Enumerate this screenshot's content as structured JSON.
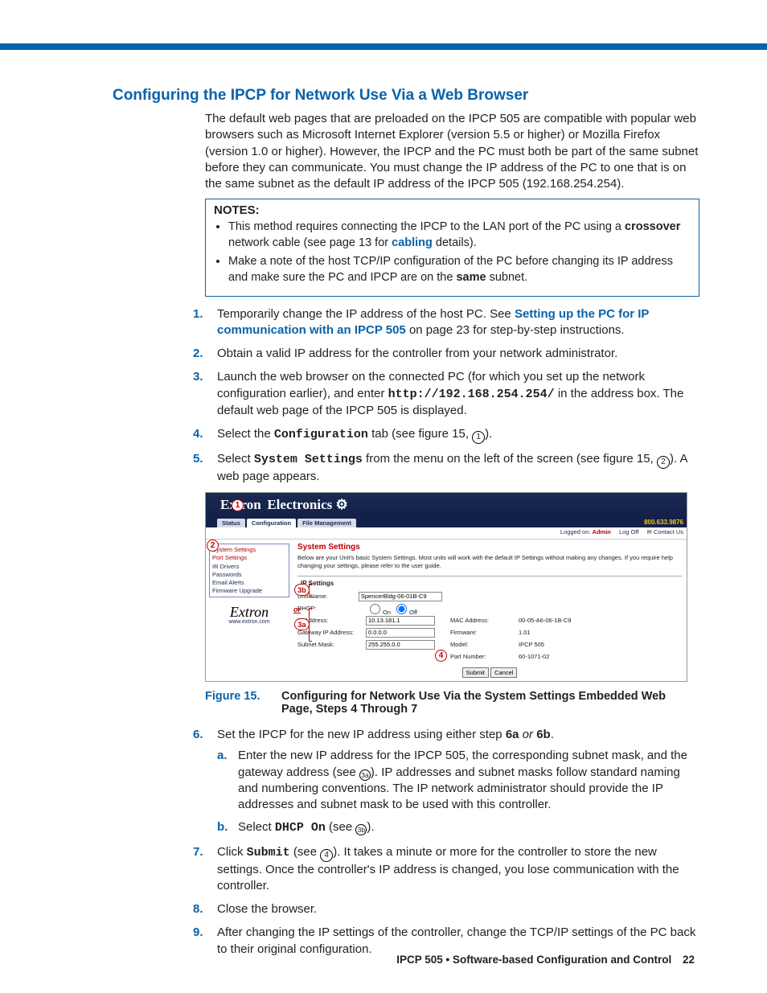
{
  "heading": "Configuring the IPCP for Network Use Via a Web Browser",
  "intro": "The default web pages that are preloaded on the IPCP 505 are compatible with popular web browsers such as Microsoft Internet Explorer (version 5.5 or higher) or Mozilla Firefox (version 1.0 or higher). However, the IPCP and the PC must both be part of the same subnet before they can communicate. You must change the IP address of the PC to one that is on the same subnet as the default IP address of the IPCP 505 (192.168.254.254).",
  "notes_label": "NOTES:",
  "notes": {
    "n1_a": "This method requires connecting the IPCP to the LAN port of the PC using a ",
    "n1_b": "crossover",
    "n1_c": " network cable (see page 13 for ",
    "n1_link": "cabling",
    "n1_d": " details).",
    "n2_a": "Make a note of the host TCP/IP configuration of the PC before changing its IP address and make sure the PC and IPCP are on the ",
    "n2_b": "same",
    "n2_c": " subnet."
  },
  "steps": {
    "s1_a": "Temporarily change the IP address of the host PC. See ",
    "s1_link": "Setting up the PC for IP communication with an IPCP 505",
    "s1_b": " on page 23 for step-by-step instructions.",
    "s2": "Obtain a valid IP address for the controller from your network administrator.",
    "s3_a": "Launch the web browser on the connected PC (for which you set up the network configuration earlier), and enter ",
    "s3_code": "http://192.168.254.254/",
    "s3_b": " in the address box. The default web page of the IPCP 505 is displayed.",
    "s4_a": "Select the ",
    "s4_code": "Configuration",
    "s4_b": " tab (see figure 15, ",
    "s4_c": ").",
    "s5_a": "Select ",
    "s5_code": "System Settings",
    "s5_b": " from the menu on the left of the screen (see figure 15, ",
    "s5_c": "). A web page appears.",
    "s6_a": "Set the IPCP for the new IP address using either step ",
    "s6_b": "6a",
    "s6_or": " or ",
    "s6_c": "6b",
    "s6_d": ".",
    "s6a_a": "Enter the new IP address for the IPCP 505, the corresponding subnet mask, and the gateway address (see ",
    "s6a_b": "). IP addresses and subnet masks follow standard naming and numbering conventions. The IP network administrator should provide the IP addresses and subnet mask to be used with this controller.",
    "s6b_a": "Select ",
    "s6b_code": "DHCP On",
    "s6b_b": " (see ",
    "s6b_c": ").",
    "s7_a": "Click ",
    "s7_code": "Submit",
    "s7_b": " (see ",
    "s7_c": "). It takes a minute or more for the controller to store the new settings. Once the controller's IP address is changed, you lose communication with the controller.",
    "s8": "Close the browser.",
    "s9": "After changing the IP settings of the controller, change the TCP/IP settings of the PC back to their original configuration."
  },
  "callout_labels": {
    "c1": "1",
    "c2": "2",
    "c3a": "3a",
    "c3b": "3b",
    "c4": "4",
    "or": "or"
  },
  "fig_label": "Figure 15.",
  "fig_text": "Configuring for Network Use Via the System Settings Embedded Web Page, Steps 4 Through 7",
  "webshot": {
    "brand": "Extron  Electronics ⚙",
    "phone": "800.633.9876",
    "tabs": {
      "status": "Status",
      "config": "Configuration",
      "file": "File Management"
    },
    "top": {
      "logged": "Logged on: ",
      "admin": "Admin",
      "logoff": "Log Off",
      "contact": "✉ Contact Us"
    },
    "side": {
      "system": "System Settings",
      "port": "Port Settings",
      "ir": "IR Drivers",
      "pw": "Passwords",
      "email": "Email Alerts",
      "fw": "Firmware Upgrade"
    },
    "logo_url": "www.extron.com",
    "title": "System Settings",
    "desc": "Below are your Unit's basic System Settings. Most units will work with the default IP Settings without making any changes. If you require help changing your settings, please refer to the user guide.",
    "panel_title": "IP Settings",
    "fields": {
      "unit_lbl": "Unit Name:",
      "unit_val": "SpencerBldg-06-01B-C9",
      "dhcp_lbl": "DHCP:",
      "dhcp_on": "On",
      "dhcp_off": "Off",
      "ip_lbl": "IP Address:",
      "ip_val": "10.13.181.1",
      "gw_lbl": "Gateway IP Address:",
      "gw_val": "0.0.0.0",
      "mask_lbl": "Subnet Mask:",
      "mask_val": "255.255.0.0",
      "mac_lbl": "MAC Address:",
      "mac_val": "00-05-A6-06-1B-C9",
      "fw_lbl": "Firmware:",
      "fw_val": "1.01",
      "model_lbl": "Model:",
      "model_val": "IPCP 505",
      "part_lbl": "Part Number:",
      "part_val": "60-1071-02"
    },
    "submit": "Submit",
    "cancel": "Cancel"
  },
  "footer": {
    "section": "IPCP 505 • Software-based Configuration and Control",
    "page": "22"
  }
}
